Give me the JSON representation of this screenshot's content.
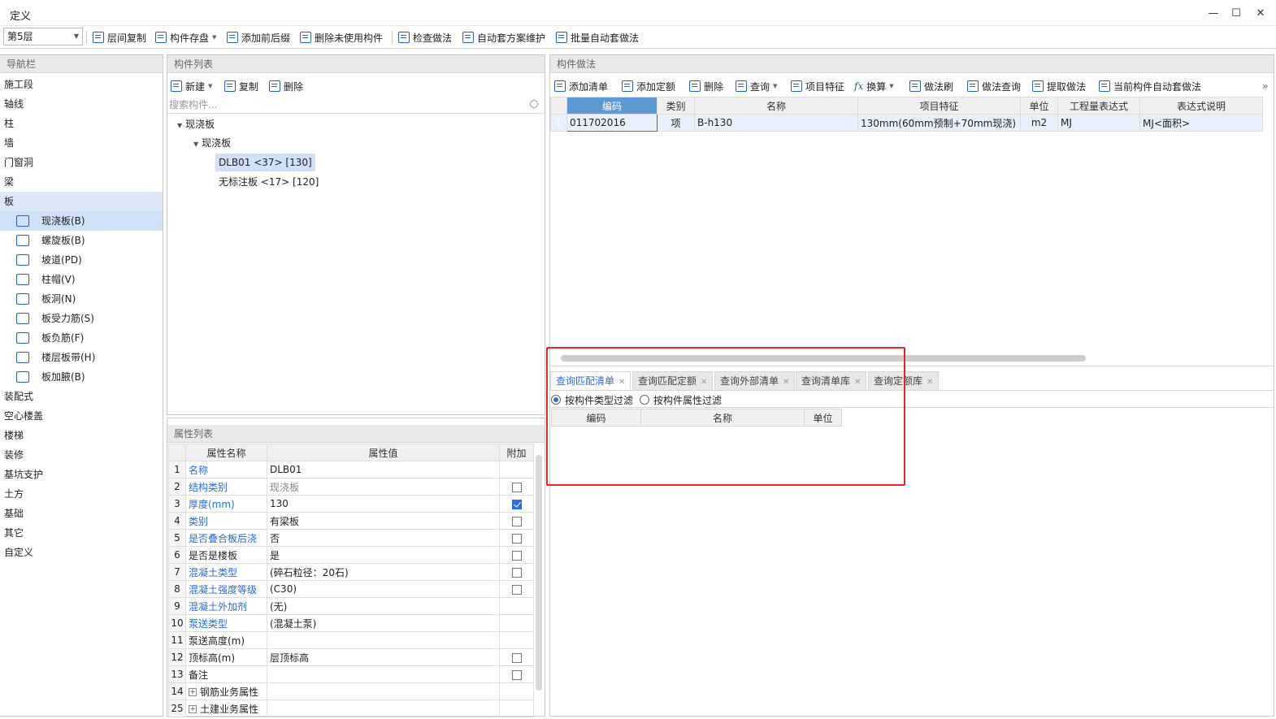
{
  "window": {
    "title": "定义",
    "min": "—",
    "max": "☐",
    "close": "✕"
  },
  "toolbar": {
    "floor": "第5层",
    "buttons": [
      "层间复制",
      "构件存盘",
      "添加前后缀",
      "删除未使用构件",
      "检查做法",
      "自动套方案维护",
      "批量自动套做法"
    ]
  },
  "nav": {
    "header": "导航栏",
    "items_top": [
      "施工段",
      "轴线",
      "柱",
      "墙",
      "门窗洞",
      "梁",
      "板"
    ],
    "sub_items": [
      "现浇板(B)",
      "螺旋板(B)",
      "坡道(PD)",
      "柱帽(V)",
      "板洞(N)",
      "板受力筋(S)",
      "板负筋(F)",
      "楼层板带(H)",
      "板加腋(B)"
    ],
    "items_bottom": [
      "装配式",
      "空心楼盖",
      "楼梯",
      "装修",
      "基坑支护",
      "土方",
      "基础",
      "其它",
      "自定义"
    ]
  },
  "component_list": {
    "header": "构件列表",
    "new": "新建",
    "copy": "复制",
    "delete": "删除",
    "search_placeholder": "搜索构件...",
    "tree": {
      "root": "现浇板",
      "child": "现浇板",
      "leaf1": "DLB01 <37> [130]",
      "leaf2": "无标注板 <17> [120]"
    }
  },
  "properties": {
    "header": "属性列表",
    "columns": [
      "属性名称",
      "属性值",
      "附加"
    ],
    "rows": [
      {
        "n": "1",
        "name": "名称",
        "value": "DLB01"
      },
      {
        "n": "2",
        "name": "结构类别",
        "value": "现浇板"
      },
      {
        "n": "3",
        "name": "厚度(mm)",
        "value": "130"
      },
      {
        "n": "4",
        "name": "类别",
        "value": "有梁板"
      },
      {
        "n": "5",
        "name": "是否叠合板后浇",
        "value": "否"
      },
      {
        "n": "6",
        "name": "是否是楼板",
        "value": "是"
      },
      {
        "n": "7",
        "name": "混凝土类型",
        "value": "(碎石粒径：20石)"
      },
      {
        "n": "8",
        "name": "混凝土强度等级",
        "value": "(C30)"
      },
      {
        "n": "9",
        "name": "混凝土外加剂",
        "value": "(无)"
      },
      {
        "n": "10",
        "name": "泵送类型",
        "value": "(混凝土泵)"
      },
      {
        "n": "11",
        "name": "泵送高度(m)",
        "value": ""
      },
      {
        "n": "12",
        "name": "顶标高(m)",
        "value": "层顶标高"
      },
      {
        "n": "13",
        "name": "备注",
        "value": ""
      },
      {
        "n": "14",
        "name": "钢筋业务属性",
        "value": ""
      },
      {
        "n": "25",
        "name": "土建业务属性",
        "value": ""
      }
    ]
  },
  "method": {
    "header": "构件做法",
    "tools": [
      "添加清单",
      "添加定额",
      "删除",
      "查询",
      "项目特征",
      "换算",
      "做法刷",
      "做法查询",
      "提取做法",
      "当前构件自动套做法"
    ],
    "columns": [
      "编码",
      "类别",
      "名称",
      "项目特征",
      "单位",
      "工程量表达式",
      "表达式说明"
    ],
    "row": {
      "n": "1",
      "code": "011702016",
      "type": "项",
      "name": "B-h130",
      "feature": "130mm(60mm预制+70mm现浇)",
      "unit": "m2",
      "expr": "MJ",
      "desc": "MJ<面积>"
    },
    "overflow": "»"
  },
  "query": {
    "tabs": [
      "查询匹配清单",
      "查询匹配定额",
      "查询外部清单",
      "查询清单库",
      "查询定额库"
    ],
    "filter_type": "按构件类型过滤",
    "filter_attr": "按构件属性过滤",
    "columns": [
      "编码",
      "名称",
      "单位"
    ]
  }
}
